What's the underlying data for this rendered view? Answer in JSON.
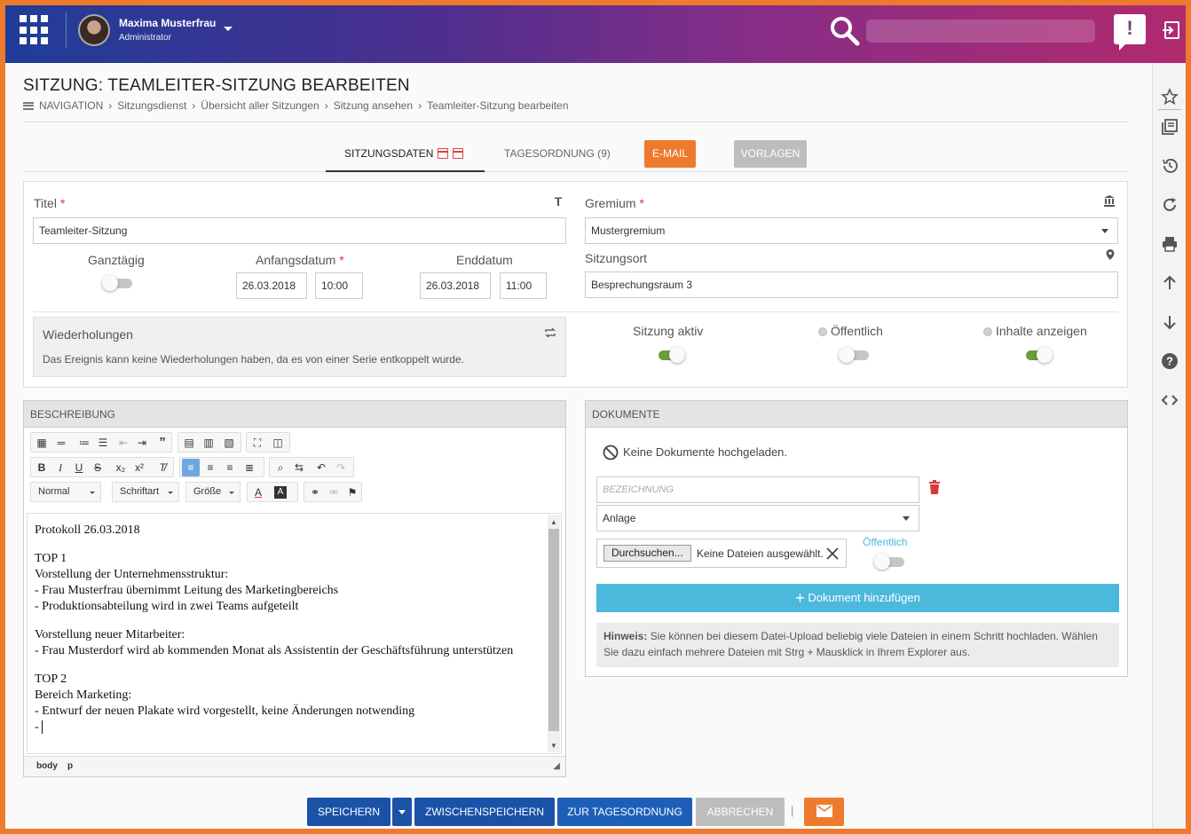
{
  "topbar": {
    "user_name": "Maxima Musterfrau",
    "user_role": "Administrator",
    "notification": "!"
  },
  "page": {
    "title": "SITZUNG: TEAMLEITER-SITZUNG BEARBEITEN",
    "breadcrumb": [
      "NAVIGATION",
      "Sitzungsdienst",
      "Übersicht aller Sitzungen",
      "Sitzung ansehen",
      "Teamleiter-Sitzung bearbeiten"
    ],
    "breadcrumb_sep": "›"
  },
  "tabs": {
    "sitzungsdaten": "SITZUNGSDATEN",
    "tagesordnung": "TAGESORDNUNG (9)",
    "email": "E-MAIL",
    "vorlagen": "VORLAGEN"
  },
  "form": {
    "titel_label": "Titel",
    "titel_value": "Teamleiter-Sitzung",
    "gremium_label": "Gremium",
    "gremium_value": "Mustergremium",
    "ganztaegig_label": "Ganztägig",
    "ganztaegig_on": false,
    "anfangsdatum_label": "Anfangsdatum",
    "anfangsdatum_date": "26.03.2018",
    "anfangsdatum_time": "10:00",
    "enddatum_label": "Enddatum",
    "enddatum_date": "26.03.2018",
    "enddatum_time": "11:00",
    "sitzungsort_label": "Sitzungsort",
    "sitzungsort_value": "Besprechungsraum 3",
    "required_mark": "*",
    "wiederholungen_title": "Wiederholungen",
    "wiederholungen_text": "Das Ereignis kann keine Wiederholungen haben, da es von einer Serie entkoppelt wurde.",
    "sitzung_aktiv_label": "Sitzung aktiv",
    "sitzung_aktiv_on": true,
    "oeffentlich_label": "Öffentlich",
    "oeffentlich_on": false,
    "inhalte_label": "Inhalte anzeigen",
    "inhalte_on": true
  },
  "beschreibung": {
    "header": "BESCHREIBUNG",
    "format_normal": "Normal",
    "format_font": "Schriftart",
    "format_size": "Größe",
    "lines": [
      "Protokoll 26.03.2018",
      "",
      "TOP 1",
      "Vorstellung der Unternehmensstruktur:",
      "- Frau Musterfrau übernimmt Leitung des Marketingbereichs",
      "- Produktionsabteilung wird in zwei Teams aufgeteilt",
      "",
      "Vorstellung neuer Mitarbeiter:",
      "- Frau Musterdorf wird ab kommenden Monat als Assistentin der Geschäftsführung unterstützen",
      "",
      "TOP 2",
      "Bereich Marketing:",
      "- Entwurf der neuen Plakate wird vorgestellt, keine Änderungen notwending",
      "- "
    ],
    "footer_path": [
      "body",
      "p"
    ]
  },
  "dokumente": {
    "header": "DOKUMENTE",
    "empty_text": "Keine Dokumente hochgeladen.",
    "bezeichnung_placeholder": "BEZEICHNUNG",
    "type_value": "Anlage",
    "browse_label": "Durchsuchen...",
    "file_status": "Keine Dateien ausgewählt.",
    "public_label": "Öffentlich",
    "public_on": false,
    "add_label": "Dokument hinzufügen",
    "hint_bold": "Hinweis:",
    "hint_text": " Sie können bei diesem Datei-Upload beliebig viele Dateien in einem Schritt hochladen. Wählen Sie dazu einfach mehrere Dateien mit Strg + Mausklick in Ihrem Explorer aus."
  },
  "actions": {
    "speichern": "SPEICHERN",
    "zwischenspeichern": "ZWISCHENSPEICHERN",
    "zur_tagesordnung": "ZUR TAGESORDNUNG",
    "abbrechen": "ABBRECHEN",
    "separator": "|"
  },
  "colors": {
    "accent_orange": "#ee7a2e",
    "primary_blue": "#1a52a8",
    "info_cyan": "#4cb8dc",
    "toggle_on": "#6a9e3a",
    "required_red": "#dd3333"
  },
  "icons": {
    "app_grid": "grid-icon",
    "search": "search-icon",
    "notification": "notification-icon",
    "logout": "logout-icon",
    "rail": [
      "star-icon",
      "library-icon",
      "history-icon",
      "refresh-icon",
      "print-icon",
      "arrow-up-icon",
      "arrow-down-icon",
      "help-icon",
      "code-icon"
    ]
  }
}
